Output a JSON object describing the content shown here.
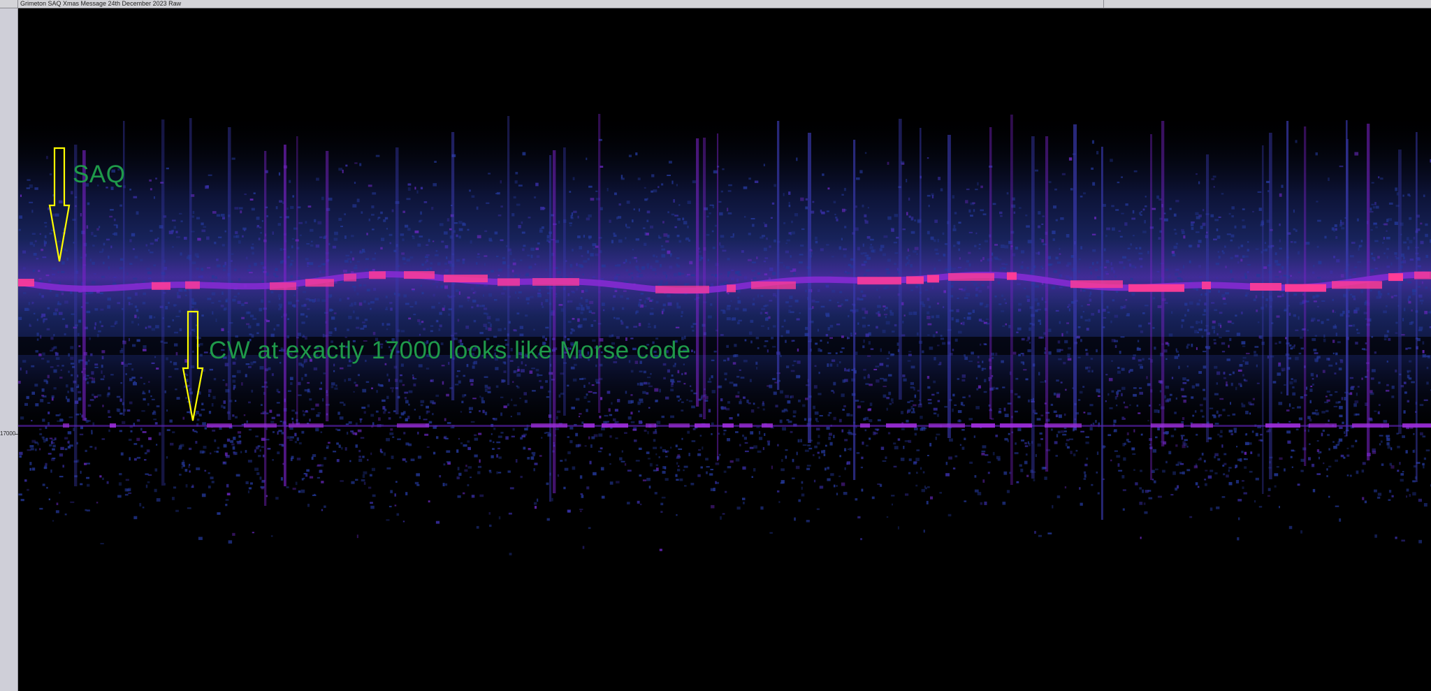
{
  "window": {
    "title": "Grimeton SAQ Xmas Message 24th December 2023 Raw"
  },
  "axis": {
    "tick_label": "17000"
  },
  "annotations": {
    "saq_label": "SAQ",
    "cw_label": "CW at exactly 17000 looks like Morse code"
  },
  "colors": {
    "background": "#000000",
    "annotation_text": "#1f9a4a",
    "arrow_outline": "#ffff00",
    "noise_blue": "#2a3a9a",
    "noise_purple": "#7a22c8",
    "signal_pink": "#ff3c96"
  },
  "icons": {
    "saq_arrow": "down-arrow-icon",
    "cw_arrow": "down-arrow-icon"
  }
}
